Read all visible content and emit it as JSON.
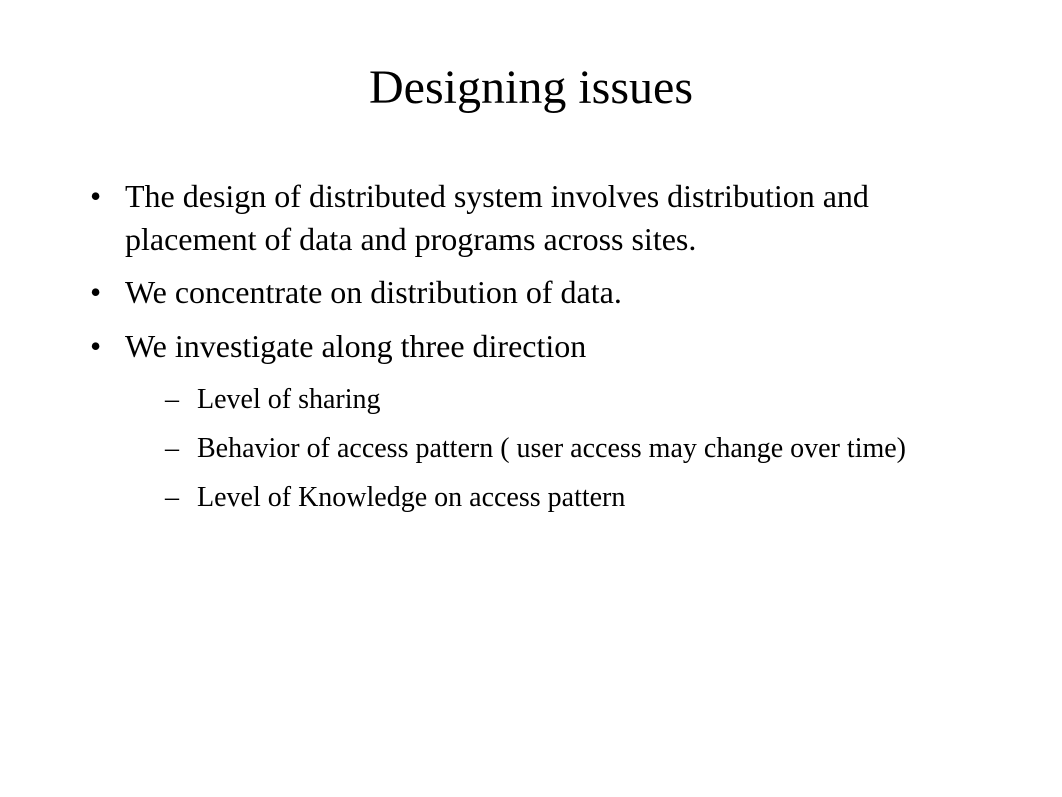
{
  "title": "Designing issues",
  "bullets": [
    "The design of distributed system involves distribution and placement of data and programs across sites.",
    "We concentrate on distribution of data.",
    "We investigate along three direction"
  ],
  "subbullets": [
    "Level of sharing",
    "Behavior of access pattern ( user access may change over time)",
    "Level of Knowledge on access pattern"
  ]
}
